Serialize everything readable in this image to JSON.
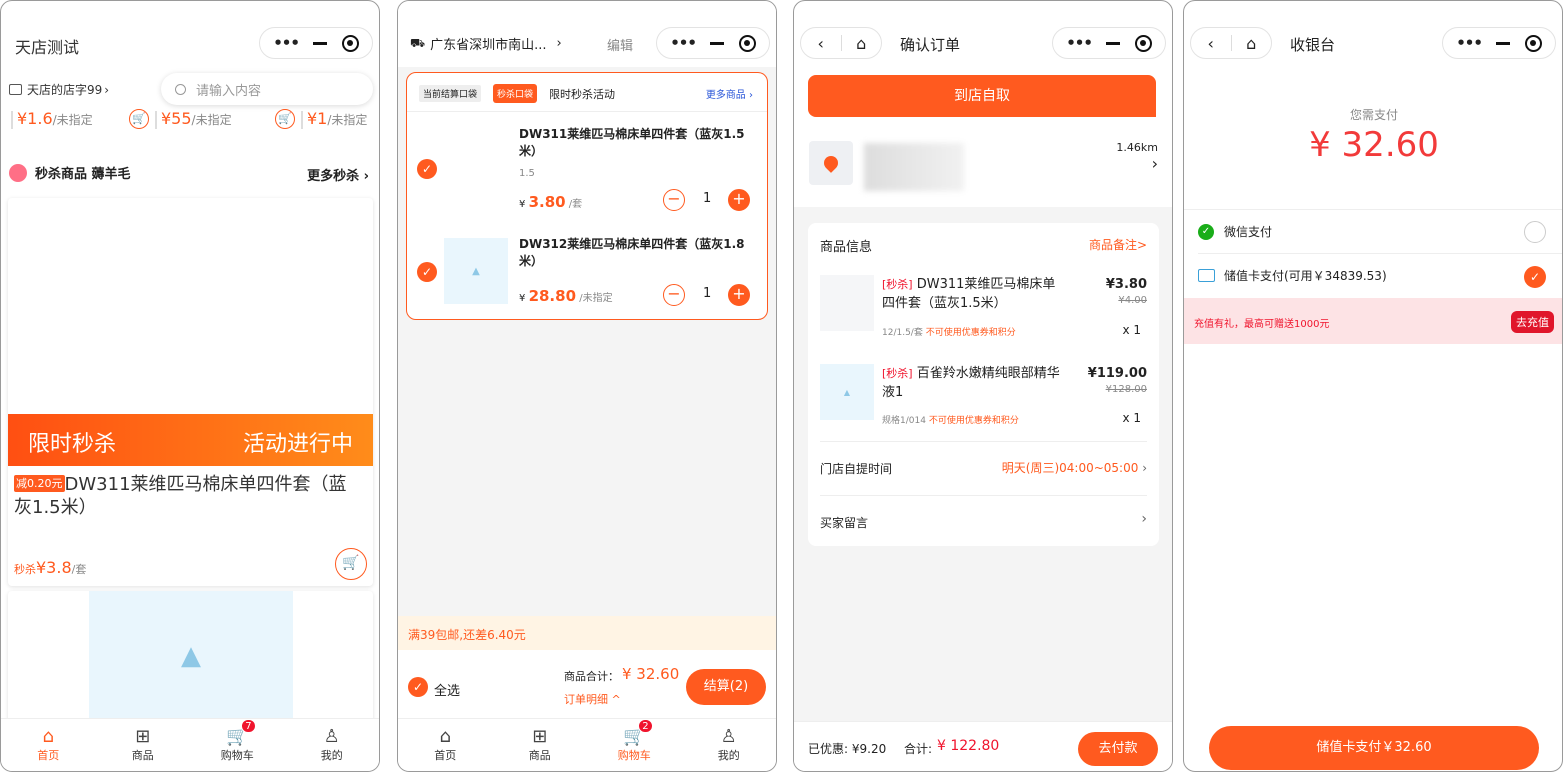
{
  "capsule": {
    "more": "•••"
  },
  "tabbar": {
    "items": [
      {
        "label": "首页",
        "icon": "home-icon"
      },
      {
        "label": "商品",
        "icon": "grid-icon"
      },
      {
        "label": "购物车",
        "icon": "cart-icon"
      },
      {
        "label": "我的",
        "icon": "user-icon"
      }
    ]
  },
  "s1": {
    "title": "天店测试",
    "store_name": "天店的店字99",
    "search_placeholder": "请输入内容",
    "prices": [
      {
        "price": "¥1.6",
        "unit": "/未指定"
      },
      {
        "price": "¥55",
        "unit": "/未指定"
      },
      {
        "price": "¥1",
        "unit": "/未指定"
      }
    ],
    "section_title": "秒杀商品 薅羊毛",
    "more_link": "更多秒杀",
    "banner_left": "限时秒杀",
    "banner_right": "活动进行中",
    "discount_tag": "减0.20元",
    "product_name": "DW311莱维匹马棉床单四件套（蓝灰1.5米）",
    "flash_label": "秒杀",
    "flash_price": "¥3.8",
    "flash_unit": "/套",
    "cart_badge": "7"
  },
  "s2": {
    "address": "广东省深圳市南山...",
    "edit": "编辑",
    "tag_current": "当前结算口袋",
    "tag_flash": "秒杀口袋",
    "activity": "限时秒杀活动",
    "more_goods": "更多商品",
    "items": [
      {
        "name": "DW311莱维匹马棉床单四件套（蓝灰1.5米）",
        "spec": "1.5",
        "price": "3.80",
        "unit": "/套",
        "qty": "1"
      },
      {
        "name": "DW312莱维匹马棉床单四件套（蓝灰1.8米）",
        "spec": "",
        "price": "28.80",
        "unit": "/未指定",
        "qty": "1"
      }
    ],
    "currency": "¥",
    "shipping_notice": "满39包邮,还差6.40元",
    "select_all": "全选",
    "total_label": "商品合计：",
    "total": "¥ 32.60",
    "detail": "订单明细",
    "checkout": "结算(2)",
    "cart_badge": "2"
  },
  "s3": {
    "title": "确认订单",
    "pickup_button": "到店自取",
    "distance": "1.46km",
    "info_title": "商品信息",
    "remark_link": "商品备注>",
    "items": [
      {
        "tag": "[秒杀]",
        "name": "DW311莱维匹马棉床单四件套（蓝灰1.5米）",
        "spec": "12/1.5/套",
        "note": "不可使用优惠券和积分",
        "price": "¥3.80",
        "orig": "¥4.00",
        "qty": "x 1"
      },
      {
        "tag": "[秒杀]",
        "name": "百雀羚水嫩精纯眼部精华液1",
        "spec": "规格1/014",
        "note": "不可使用优惠券和积分",
        "price": "¥119.00",
        "orig": "¥128.00",
        "qty": "x 1"
      }
    ],
    "pickup_time_label": "门店自提时间",
    "pickup_time": "明天(周三)04:00~05:00",
    "message_label": "买家留言",
    "discount_label": "已优惠: ¥9.20",
    "total_label": "合计:",
    "total": "¥ 122.80",
    "pay_button": "去付款"
  },
  "s4": {
    "title": "收银台",
    "need_pay": "您需支付",
    "amount": "¥ 32.60",
    "wechat": "微信支付",
    "stored_card": "储值卡支付(可用￥34839.53)",
    "promo": "充值有礼，最高可赠送1000元",
    "recharge": "去充值",
    "pay_button": "储值卡支付￥32.60"
  },
  "colors": {
    "accent": "#ff5a1f",
    "price_red": "#f0142d",
    "banner": "#ff6a1a"
  }
}
